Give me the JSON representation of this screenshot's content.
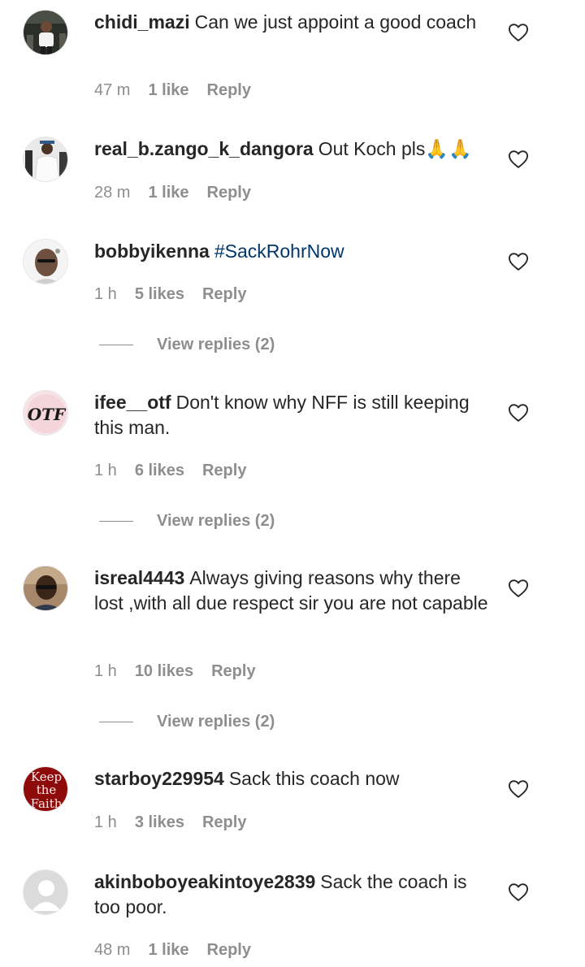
{
  "comments": [
    {
      "username": "chidi_mazi",
      "text": "Can we just appoint a good coach",
      "time": "47 m",
      "likes": "1 like",
      "reply": "Reply"
    },
    {
      "username": "real_b.zango_k_dangora",
      "text": "Out Koch pls🙏🙏",
      "time": "28 m",
      "likes": "1 like",
      "reply": "Reply"
    },
    {
      "username": "bobbyikenna",
      "hashtag": "#SackRohrNow",
      "time": "1 h",
      "likes": "5 likes",
      "reply": "Reply",
      "view_replies": "View replies (2)"
    },
    {
      "username": "ifee__otf",
      "text": "Don't know why NFF is still keeping this man.",
      "time": "1 h",
      "likes": "6 likes",
      "reply": "Reply",
      "view_replies": "View replies (2)",
      "avatar_text": "OTF"
    },
    {
      "username": "isreal4443",
      "text": "Always giving reasons why there lost ,with all due respect sir you are not capable",
      "time": "1 h",
      "likes": "10 likes",
      "reply": "Reply",
      "view_replies": "View replies (2)"
    },
    {
      "username": "starboy229954",
      "text": "Sack this coach now",
      "time": "1 h",
      "likes": "3 likes",
      "reply": "Reply",
      "avatar_lines": [
        "Keep",
        "the",
        "Faith"
      ]
    },
    {
      "username": "akinboboyeakintoye2839",
      "text": "Sack the coach is too poor.",
      "time": "48 m",
      "likes": "1 like",
      "reply": "Reply"
    }
  ],
  "icons": {
    "like": "heart-outline-icon"
  },
  "colors": {
    "text": "#262626",
    "secondary": "#8e8e8e",
    "hashtag": "#00376b"
  }
}
